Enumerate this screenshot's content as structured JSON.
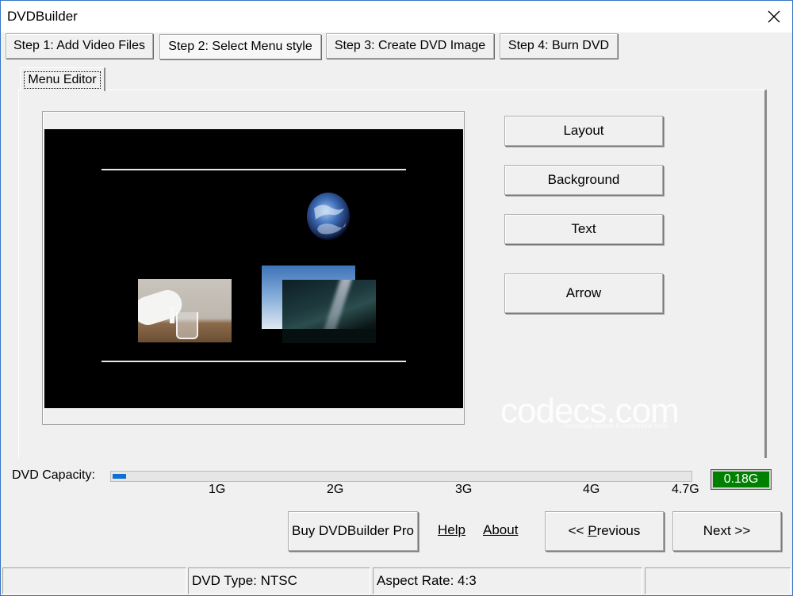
{
  "window": {
    "title": "DVDBuilder"
  },
  "steps": [
    {
      "label": "Step 1: Add Video Files"
    },
    {
      "label": "Step 2: Select Menu style"
    },
    {
      "label": "Step 3: Create DVD Image"
    },
    {
      "label": "Step 4: Burn DVD"
    }
  ],
  "tab": {
    "label": "Menu Editor"
  },
  "menu_buttons": {
    "layout": "Layout",
    "background": "Background",
    "text": "Text",
    "arrow": "Arrow"
  },
  "capacity": {
    "label": "DVD Capacity:",
    "value": "0.18G",
    "used_gb": 0.18,
    "max_gb": 4.7,
    "ticks": [
      "1G",
      "2G",
      "3G",
      "4G",
      "4.7G"
    ]
  },
  "actions": {
    "buy": "Buy DVDBuilder Pro",
    "help": "Help",
    "about": "About",
    "previous_prefix": "<< ",
    "previous_accel": "P",
    "previous_rest": "revious",
    "next": "Next >>"
  },
  "status": {
    "dvd_type": "DVD Type: NTSC",
    "aspect": "Aspect Rate: 4:3"
  },
  "watermark": {
    "text": "codecs.com",
    "sub": "Download codecs & multimedia tools"
  }
}
